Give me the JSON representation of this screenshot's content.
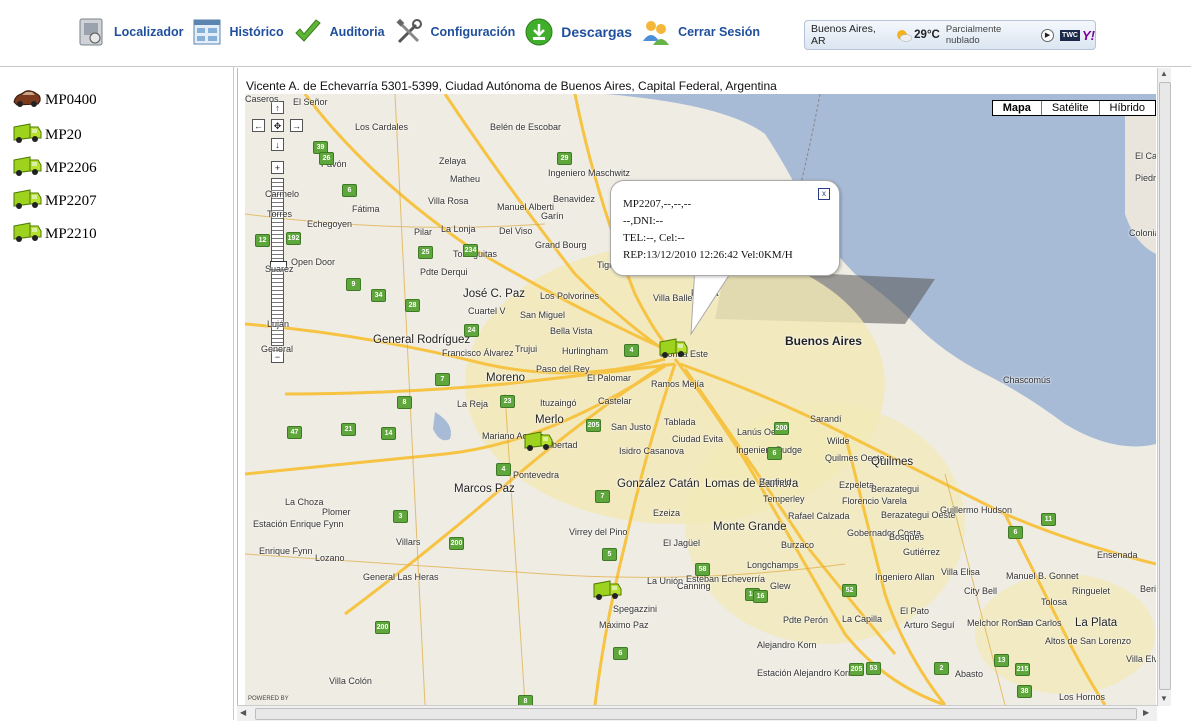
{
  "nav": {
    "items": [
      {
        "label": "Localizador",
        "icon": "locator-icon"
      },
      {
        "label": "Histórico",
        "icon": "history-icon"
      },
      {
        "label": "Auditoria",
        "icon": "audit-check-icon"
      },
      {
        "label": "Configuración",
        "icon": "settings-tools-icon"
      },
      {
        "label": "Descargas",
        "icon": "download-icon"
      },
      {
        "label": "Cerrar Sesión",
        "icon": "logout-users-icon"
      }
    ]
  },
  "weather": {
    "city": "Buenos Aires, AR",
    "temp": "29°C",
    "condition": "Parcialmente nublado",
    "twc": "TWC",
    "yahoo": "Y!"
  },
  "vehicles": [
    {
      "id": "MP0400",
      "type": "car"
    },
    {
      "id": "MP20",
      "type": "truck"
    },
    {
      "id": "MP2206",
      "type": "truck"
    },
    {
      "id": "MP2207",
      "type": "truck"
    },
    {
      "id": "MP2210",
      "type": "truck"
    }
  ],
  "map": {
    "address": "Vicente A. de Echevarría 5301-5399, Ciudad Autónoma de Buenos Aires, Capital Federal, Argentina",
    "types": [
      "Mapa",
      "Satélite",
      "Híbrido"
    ],
    "powered": "POWERED BY",
    "zoom_plus": "+",
    "zoom_minus": "−",
    "labels": [
      "El Señor",
      "Los Cardales",
      "Belén de Escobar",
      "Pavón",
      "Zelaya",
      "Ingeniero Maschwitz",
      "Matheu",
      "Manuel Alberti",
      "Benavidez",
      "Fátima",
      "Villa Rosa",
      "Garín",
      "Echegoyen",
      "Pilar",
      "La Lonja",
      "Del Viso",
      "Tortuguitas",
      "Grand Bourg",
      "Open Door",
      "Pdte Derqui",
      "José C. Paz",
      "Los Polvorines",
      "Cuartel V",
      "San Miguel",
      "Bella Vista",
      "Villa Ballester",
      "Hurlingham",
      "Trujui",
      "General Rodríguez",
      "Francisco Álvarez",
      "Moreno",
      "Paso del Rey",
      "El Palomar",
      "Ramos Mejía",
      "Ituzaingó",
      "Castelar",
      "La Reja",
      "Merlo",
      "San Justo",
      "Tablada",
      "Lanús Oeste",
      "Mariano Acosta",
      "Libertad",
      "Isidro Casanova",
      "Ciudad Evita",
      "Ingeniero Budge",
      "Pontevedra",
      "Marcos Paz",
      "González Catán",
      "Lomas de Zamora",
      "Banfield",
      "Temperley",
      "La Choza",
      "Plomer",
      "Ezeiza",
      "Estación Enrique Fynn",
      "Villars",
      "Virrey del Pino",
      "El Jagüel",
      "Monte Grande",
      "Enrique Fynn",
      "Lozano",
      "Longchamps",
      "General Las Heras",
      "La Unión",
      "Canning",
      "Glew",
      "Spegazzini",
      "Esteban Echeverría",
      "Máximo Paz",
      "Pdte Perón",
      "Alejandro Korn",
      "Estación Alejandro Korn",
      "Villa Colón",
      "Sarandí",
      "Wilde",
      "Quilmes Oeste",
      "Quilmes",
      "Ezpeleta",
      "Berazategui",
      "Florencio Varela",
      "Rafael Calzada",
      "Burzaco",
      "Gobernador Costa",
      "Berazategui Oeste",
      "Bosques",
      "Gutiérrez",
      "Guillermo Hudson",
      "Ingeniero Allan",
      "Villa Elisa",
      "Manuel B. Gonnet",
      "City Bell",
      "Ringuelet",
      "Ensenada",
      "Berisso",
      "El Pato",
      "La Capilla",
      "Arturo Seguí",
      "Melchor Romero",
      "San Carlos",
      "La Plata",
      "Altos de San Lorenzo",
      "Villa Elvira",
      "Abasto",
      "Los Hornos",
      "Tolosa",
      "Chascomús",
      "El Can",
      "Piedra la Gata",
      "Colonia Sacramento",
      "Carmelo",
      "Buenos Aires",
      "Florida",
      "Tigre",
      "General",
      "Suarez",
      "Luján",
      "Torres",
      "Florida Este",
      "Caseros"
    ],
    "routes": [
      "39",
      "26",
      "29",
      "6",
      "25",
      "234",
      "9",
      "192",
      "12",
      "34",
      "28",
      "24",
      "4",
      "7",
      "23",
      "8",
      "47",
      "21",
      "14",
      "205",
      "200",
      "6",
      "4",
      "3",
      "7",
      "5",
      "58",
      "16",
      "52",
      "53",
      "205",
      "2",
      "13",
      "215",
      "38",
      "11",
      "6",
      "200",
      "16",
      "200",
      "6",
      "8"
    ],
    "popup": {
      "line1": "MP2207,--,--,--",
      "line2": "--,DNI:--",
      "line3": "TEL:--, Cel:--",
      "line4": "REP:13/12/2010 12:26:42 Vel:0KM/H",
      "close": "x"
    }
  }
}
